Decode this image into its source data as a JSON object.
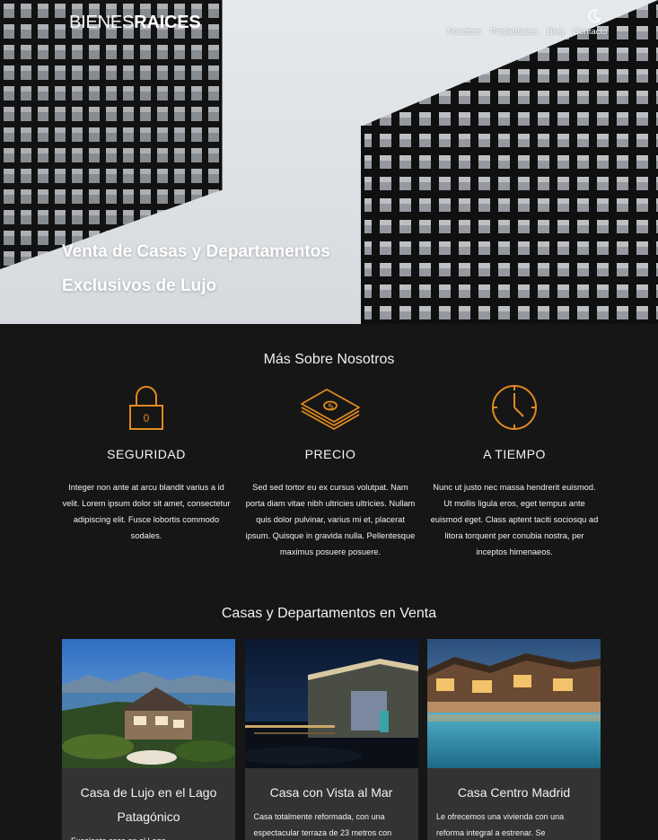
{
  "header": {
    "logo_light": "BIENES",
    "logo_bold": "RAICES",
    "nav": [
      "Nosotros",
      "Propiedades",
      "Blog",
      "Contacto"
    ],
    "theme_icon": "moon-icon"
  },
  "hero": {
    "title": "Venta de Casas y Departamentos Exclusivos de Lujo"
  },
  "about": {
    "title": "Más Sobre Nosotros",
    "features": [
      {
        "icon": "lock-icon",
        "title": "SEGURIDAD",
        "text": "Integer non ante at arcu blandit varius a id velit. Lorem ipsum dolor sit amet, consectetur adipiscing elit. Fusce lobortis commodo sodales."
      },
      {
        "icon": "money-stack-icon",
        "title": "PRECIO",
        "text": "Sed sed tortor eu ex cursus volutpat. Nam porta diam vitae nibh ultricies ultricies. Nullam quis dolor pulvinar, varius mi et, placerat ipsum. Quisque in gravida nulla. Pellentesque maximus posuere posuere."
      },
      {
        "icon": "clock-icon",
        "title": "A TIEMPO",
        "text": "Nunc ut justo nec massa hendrerit euismod. Ut mollis ligula eros, eget tempus ante euismod eget. Class aptent taciti sociosqu ad litora torquent per conubia nostra, per inceptos himenaeos."
      }
    ]
  },
  "listings": {
    "title": "Casas y Departamentos en Venta",
    "cards": [
      {
        "title": "Casa de Lujo en el Lago Patagónico",
        "text": "Excelente casa en el Lago"
      },
      {
        "title": "Casa con Vista al Mar",
        "text": "Casa totalmente reformada, con una espectacular terraza de 23 metros con"
      },
      {
        "title": "Casa Centro Madrid",
        "text": "Le ofrecemos una vivienda con una reforma integral a estrenar. Se"
      }
    ]
  },
  "colors": {
    "accent": "#e08a1e",
    "background": "#161616",
    "card": "#333333"
  }
}
